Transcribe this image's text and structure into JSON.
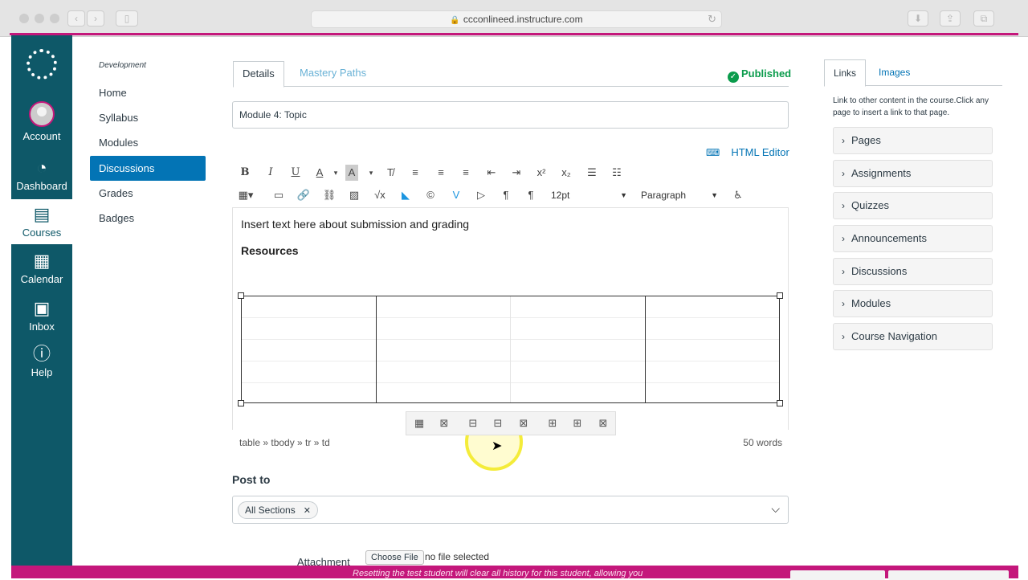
{
  "browser": {
    "url": "ccconlineed.instructure.com"
  },
  "global_nav": {
    "items": [
      {
        "label": "Account",
        "icon": "avatar"
      },
      {
        "label": "Dashboard",
        "icon": "speedometer-icon"
      },
      {
        "label": "Courses",
        "icon": "book-icon"
      },
      {
        "label": "Calendar",
        "icon": "calendar-icon"
      },
      {
        "label": "Inbox",
        "icon": "inbox-icon"
      },
      {
        "label": "Help",
        "icon": "help-icon"
      }
    ]
  },
  "course_nav": {
    "breadcrumb": "Development",
    "items": [
      {
        "label": "Home"
      },
      {
        "label": "Syllabus"
      },
      {
        "label": "Modules"
      },
      {
        "label": "Discussions"
      },
      {
        "label": "Grades"
      },
      {
        "label": "Badges"
      }
    ],
    "active": "Discussions"
  },
  "main": {
    "tabs": [
      {
        "label": "Details"
      },
      {
        "label": "Mastery Paths"
      }
    ],
    "status": "Published",
    "title_value": "Module 4: Topic",
    "html_editor_label": "HTML Editor",
    "toolbar": {
      "font_size": "12pt",
      "block_format": "Paragraph"
    },
    "content": {
      "line1": "Insert text here about submission and grading",
      "line2": "Resources"
    },
    "statusbar": {
      "path": "table » tbody » tr » td",
      "word_count": "50 words"
    },
    "post_to": {
      "label": "Post to",
      "chip": "All Sections"
    },
    "attachment": {
      "label": "Attachment",
      "button": "Choose File",
      "status": "no file selected"
    }
  },
  "right_sidebar": {
    "tabs": [
      {
        "label": "Links"
      },
      {
        "label": "Images"
      }
    ],
    "description": "Link to other content in the course.Click any page to insert a link to that page.",
    "sections": [
      {
        "label": "Pages"
      },
      {
        "label": "Assignments"
      },
      {
        "label": "Quizzes"
      },
      {
        "label": "Announcements"
      },
      {
        "label": "Discussions"
      },
      {
        "label": "Modules"
      },
      {
        "label": "Course Navigation"
      }
    ]
  },
  "banner": {
    "message": "Resetting the test student will clear all history for this student, allowing you"
  },
  "colors": {
    "nav_bg": "#0e5868",
    "accent": "#0374b5",
    "published": "#0b9c4c",
    "magenta": "#c4177b"
  }
}
